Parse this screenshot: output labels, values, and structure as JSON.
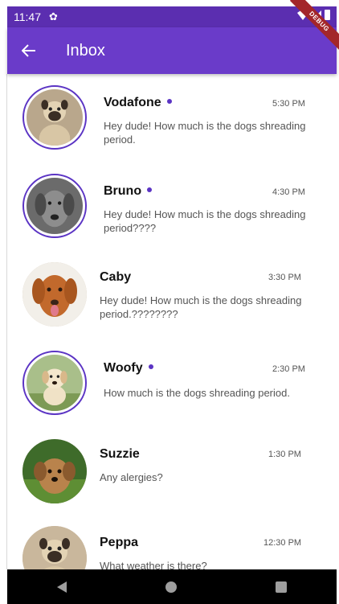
{
  "status_bar": {
    "time": "11:47",
    "debug_banner": "DEBUG"
  },
  "app_bar": {
    "title": "Inbox"
  },
  "colors": {
    "primary": "#6a3bc9",
    "status_bar": "#5b2eb0",
    "unread_dot": "#5b34c4"
  },
  "conversations": [
    {
      "name": "Vodafone",
      "time": "5:30 PM",
      "message": "Hey dude! How much is the dogs shreading period.",
      "unread": true,
      "avatar": "pug-avatar"
    },
    {
      "name": "Bruno",
      "time": "4:30 PM",
      "message": "Hey dude! How much is the dogs shreading period????",
      "unread": true,
      "avatar": "grey-dog-avatar"
    },
    {
      "name": "Caby",
      "time": "3:30 PM",
      "message": "Hey dude! How much is the dogs shreading period.????????",
      "unread": false,
      "avatar": "retriever-avatar"
    },
    {
      "name": "Woofy",
      "time": "2:30 PM",
      "message": "How much is the dogs shreading period.",
      "unread": true,
      "avatar": "puppy-avatar"
    },
    {
      "name": "Suzzie",
      "time": "1:30 PM",
      "message": "Any alergies?",
      "unread": false,
      "avatar": "fluffy-puppy-avatar"
    },
    {
      "name": "Peppa",
      "time": "12:30 PM",
      "message": "What weather is there?",
      "unread": false,
      "avatar": "pug-avatar"
    }
  ]
}
